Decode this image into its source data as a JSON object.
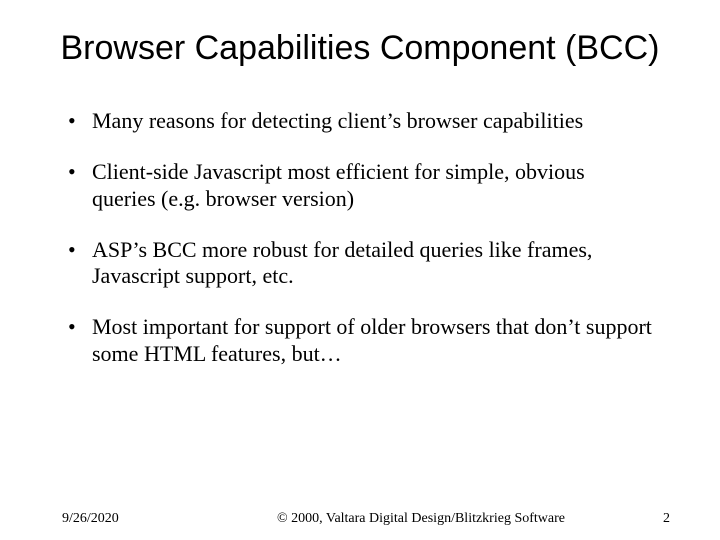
{
  "title": "Browser Capabilities Component (BCC)",
  "bullets": [
    "Many reasons for detecting client’s browser capabilities",
    "Client-side Javascript most efficient for simple, obvious queries (e.g. browser version)",
    "ASP’s BCC more robust for detailed queries like frames, Javascript support, etc.",
    "Most important for support of older browsers that don’t support some HTML features, but…"
  ],
  "footer": {
    "date": "9/26/2020",
    "copyright": "© 2000, Valtara Digital Design/Blitzkrieg Software",
    "page": "2"
  }
}
